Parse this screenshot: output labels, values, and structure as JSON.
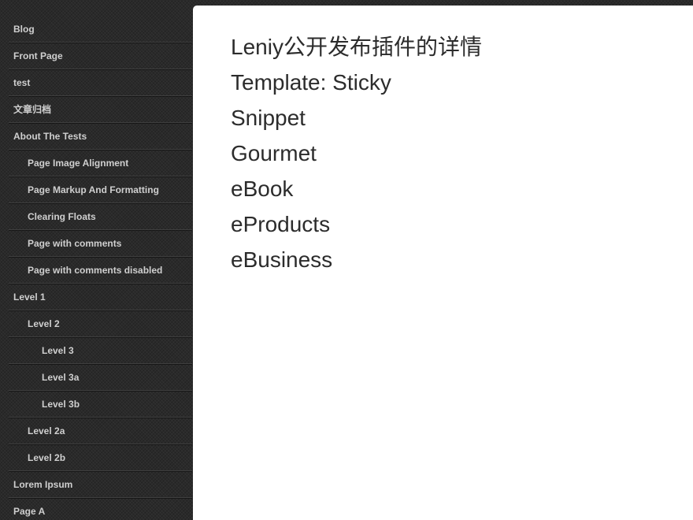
{
  "sidebar": {
    "items": [
      {
        "label": "Blog",
        "level": 0
      },
      {
        "label": "Front Page",
        "level": 0
      },
      {
        "label": "test",
        "level": 0
      },
      {
        "label": "文章归档",
        "level": 0
      },
      {
        "label": "About The Tests",
        "level": 0
      },
      {
        "label": "Page Image Alignment",
        "level": 1
      },
      {
        "label": "Page Markup And Formatting",
        "level": 1
      },
      {
        "label": "Clearing Floats",
        "level": 1
      },
      {
        "label": "Page with comments",
        "level": 1
      },
      {
        "label": "Page with comments disabled",
        "level": 1
      },
      {
        "label": "Level 1",
        "level": 0
      },
      {
        "label": "Level 2",
        "level": 1
      },
      {
        "label": "Level 3",
        "level": 2
      },
      {
        "label": "Level 3a",
        "level": 2
      },
      {
        "label": "Level 3b",
        "level": 2
      },
      {
        "label": "Level 2a",
        "level": 1
      },
      {
        "label": "Level 2b",
        "level": 1
      },
      {
        "label": "Lorem Ipsum",
        "level": 0
      },
      {
        "label": "Page A",
        "level": 0
      }
    ]
  },
  "main": {
    "posts": [
      {
        "title": "Leniy公开发布插件的详情"
      },
      {
        "title": "Template: Sticky"
      },
      {
        "title": "Snippet"
      },
      {
        "title": "Gourmet"
      },
      {
        "title": "eBook"
      },
      {
        "title": "eProducts"
      },
      {
        "title": "eBusiness"
      }
    ]
  }
}
